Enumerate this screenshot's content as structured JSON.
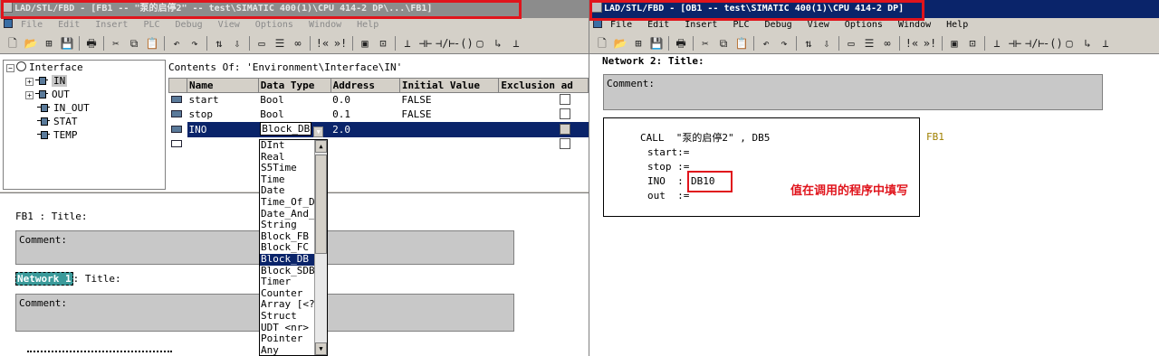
{
  "left": {
    "title": "LAD/STL/FBD  - [FB1 -- \"泵的启停2\" -- test\\SIMATIC 400(1)\\CPU 414-2 DP\\...\\FB1]",
    "menu": [
      "File",
      "Edit",
      "Insert",
      "PLC",
      "Debug",
      "View",
      "Options",
      "Window",
      "Help"
    ],
    "tree": {
      "root": "Interface",
      "items": [
        "IN",
        "OUT",
        "IN_OUT",
        "STAT",
        "TEMP"
      ]
    },
    "contents_header": "Contents Of: 'Environment\\Interface\\IN'",
    "columns": [
      "Name",
      "Data Type",
      "Address",
      "Initial Value",
      "Exclusion ad"
    ],
    "rows": [
      {
        "name": "start",
        "type": "Bool",
        "address": "0.0",
        "initial": "FALSE"
      },
      {
        "name": "stop",
        "type": "Bool",
        "address": "0.1",
        "initial": "FALSE"
      },
      {
        "name": "INO",
        "type": "Block_DB",
        "address": "2.0",
        "initial": ""
      }
    ],
    "dropdown_options": [
      "DInt",
      "Real",
      "S5Time",
      "Time",
      "Date",
      "Time_Of_D",
      "Date_And_",
      "String",
      "Block_FB",
      "Block_FC",
      "Block_DB",
      "Block_SDB",
      "Timer",
      "Counter",
      "Array [<?",
      "Struct",
      "UDT <nr>",
      "Pointer",
      "Any"
    ],
    "dropdown_selected": "Block_DB",
    "block_title": "FB1 : Title:",
    "comment_label": "Comment:",
    "network_label": "Network 1",
    "network_title": ": Title:",
    "comment_label_2": "Comment:"
  },
  "right": {
    "title": "LAD/STL/FBD  - [OB1 -- test\\SIMATIC 400(1)\\CPU 414-2 DP]",
    "menu": [
      "File",
      "Edit",
      "Insert",
      "PLC",
      "Debug",
      "View",
      "Options",
      "Window",
      "Help"
    ],
    "network_partial": "Network 2: Title:",
    "comment_label": "Comment:",
    "call_line": "CALL  \"泵的启停2\" , DB5",
    "params": [
      "start:=",
      "stop :=",
      "INO  :",
      "out  :="
    ],
    "ino_value": "DB10",
    "fb_ref": "FB1",
    "annotation": "值在调用的程序中填写"
  },
  "colors": {
    "highlight_red": "#e0141c",
    "selection_blue": "#0a246a",
    "comment_gray": "#c8c8c8"
  }
}
